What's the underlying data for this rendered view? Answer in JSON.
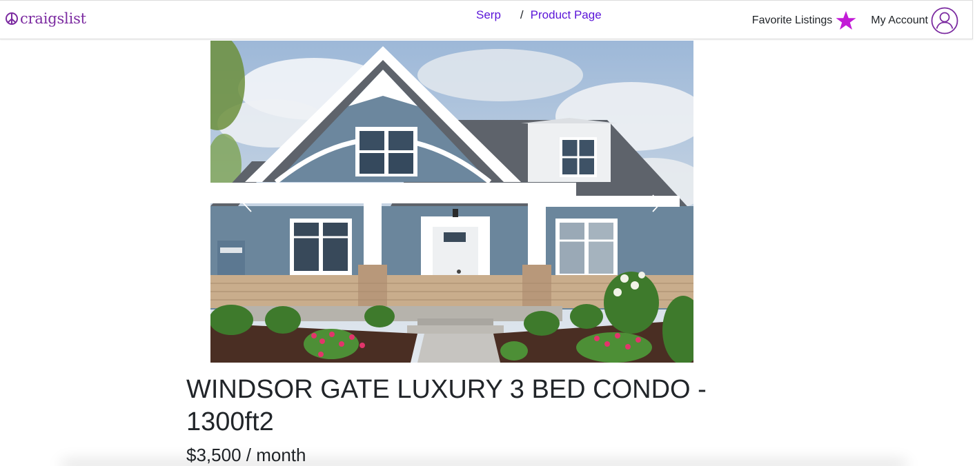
{
  "header": {
    "logo_text": "craigslist",
    "logo_icon": "peace-icon",
    "breadcrumb": [
      {
        "label": "Serp"
      },
      {
        "label": "Product Page"
      }
    ],
    "breadcrumb_separator": "/",
    "favorites_label": "Favorite Listings",
    "favorites_icon": "star-icon",
    "account_label": "My Account",
    "account_icon": "user-circle-icon"
  },
  "carousel": {
    "image_subject": "house-photo",
    "prev_icon": "chevron-left-icon",
    "next_icon": "chevron-right-icon"
  },
  "listing": {
    "title": "WINDSOR GATE LUXURY 3 BED CONDO - 1300ft2",
    "price": "$3,500 / month"
  },
  "colors": {
    "brand": "#7b2aa0",
    "link": "#5a14d8",
    "star": "#c21bd6",
    "text": "#212529"
  }
}
